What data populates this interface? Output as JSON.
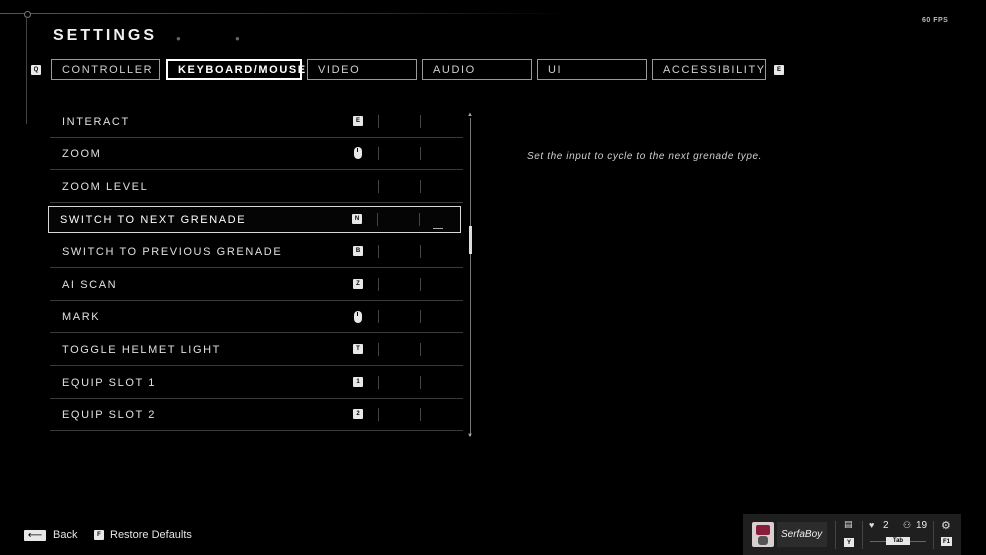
{
  "header": {
    "title": "SETTINGS",
    "fps": "60 FPS"
  },
  "tabs": {
    "prev_key": "Q",
    "next_key": "E",
    "items": [
      {
        "label": "CONTROLLER",
        "active": false
      },
      {
        "label": "KEYBOARD/MOUSE",
        "active": true
      },
      {
        "label": "VIDEO",
        "active": false
      },
      {
        "label": "AUDIO",
        "active": false
      },
      {
        "label": "UI",
        "active": false
      },
      {
        "label": "ACCESSIBILITY",
        "active": false
      }
    ]
  },
  "bindings": [
    {
      "label": "INTERACT",
      "key": "E",
      "key_type": "key"
    },
    {
      "label": "ZOOM",
      "key": "",
      "key_type": "mouse"
    },
    {
      "label": "ZOOM LEVEL",
      "key": "",
      "key_type": "none"
    },
    {
      "label": "SWITCH TO NEXT GRENADE",
      "key": "N",
      "key_type": "key",
      "selected": true
    },
    {
      "label": "SWITCH TO PREVIOUS GRENADE",
      "key": "B",
      "key_type": "key"
    },
    {
      "label": "AI SCAN",
      "key": "Z",
      "key_type": "key"
    },
    {
      "label": "MARK",
      "key": "",
      "key_type": "mouse"
    },
    {
      "label": "TOGGLE HELMET LIGHT",
      "key": "T",
      "key_type": "key"
    },
    {
      "label": "EQUIP SLOT 1",
      "key": "1",
      "key_type": "key"
    },
    {
      "label": "EQUIP SLOT 2",
      "key": "2",
      "key_type": "key"
    }
  ],
  "description": "Set the input to cycle to the next grenade type.",
  "footer": {
    "back_label": "Back",
    "back_icon": "arrow-left-icon",
    "restore_key": "F",
    "restore_label": "Restore Defaults"
  },
  "userbar": {
    "username": "SerfaBoy",
    "chat_key": "Y",
    "party_count": "2",
    "friends_count": "19",
    "tab_key": "Tab",
    "settings_key": "F1"
  }
}
